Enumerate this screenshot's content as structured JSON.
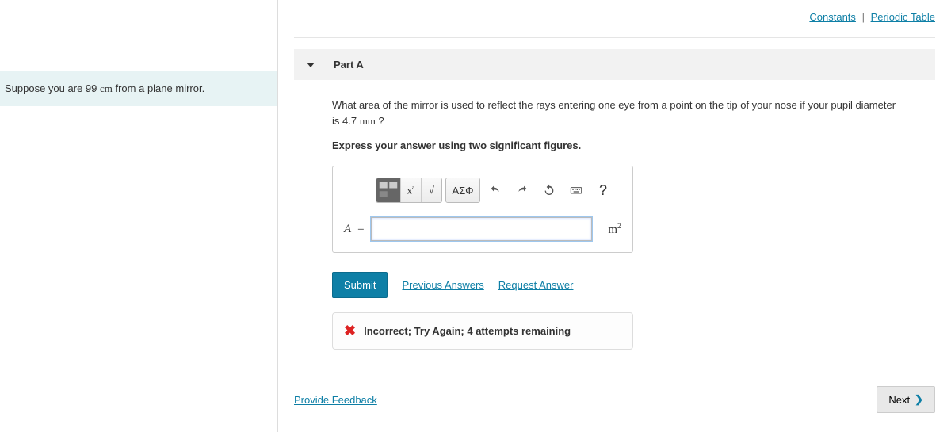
{
  "top_links": {
    "constants": "Constants",
    "periodic": "Periodic Table"
  },
  "problem": {
    "pre": "Suppose you are 99 ",
    "unit": "cm",
    "post": " from a plane mirror."
  },
  "part": {
    "label": "Part A",
    "question_pre": "What area of the mirror is used to reflect the rays entering one eye from a point on the tip of your nose if your pupil diameter is 4.7 ",
    "question_unit": "mm",
    "question_post": " ?",
    "instruction": "Express your answer using two significant figures."
  },
  "toolbar": {
    "templates": "x·10ⁿ",
    "sqrt": "√x",
    "greek": "ΑΣΦ",
    "help": "?"
  },
  "answer": {
    "symbol": "A",
    "equals": "=",
    "value": "",
    "unit_html": "m²"
  },
  "actions": {
    "submit": "Submit",
    "previous": "Previous Answers",
    "request": "Request Answer"
  },
  "feedback": {
    "message": "Incorrect; Try Again; 4 attempts remaining"
  },
  "footer": {
    "provide_feedback": "Provide Feedback",
    "next": "Next"
  }
}
